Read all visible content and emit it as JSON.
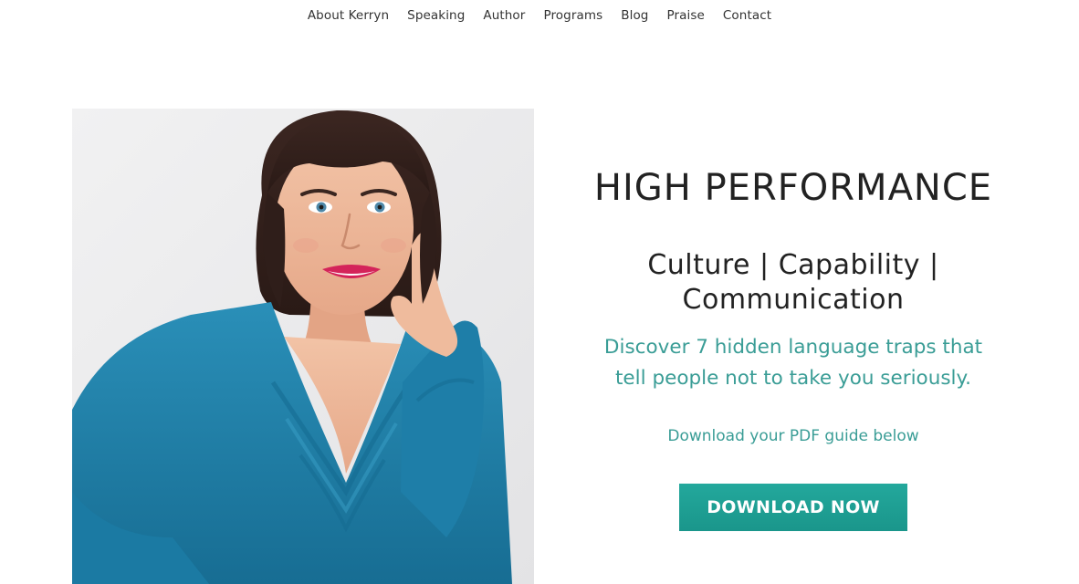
{
  "nav": {
    "items": [
      {
        "label": "About Kerryn"
      },
      {
        "label": "Speaking"
      },
      {
        "label": "Author"
      },
      {
        "label": "Programs"
      },
      {
        "label": "Blog"
      },
      {
        "label": "Praise"
      },
      {
        "label": "Contact"
      }
    ]
  },
  "hero": {
    "headline": "HIGH PERFORMANCE",
    "subheadline_line1": "Culture | Capability |",
    "subheadline_line2": "Communication",
    "tagline_line1": "Discover 7 hidden language traps that",
    "tagline_line2": "tell people not to take you seriously.",
    "subnote": "Download your PDF guide below",
    "cta_label": "DOWNLOAD NOW"
  },
  "colors": {
    "accent": "#3a9d96",
    "button": "#1fa196",
    "text": "#222222",
    "photo_background": "#e9e9ea",
    "blouse": "#1f7fa8"
  }
}
